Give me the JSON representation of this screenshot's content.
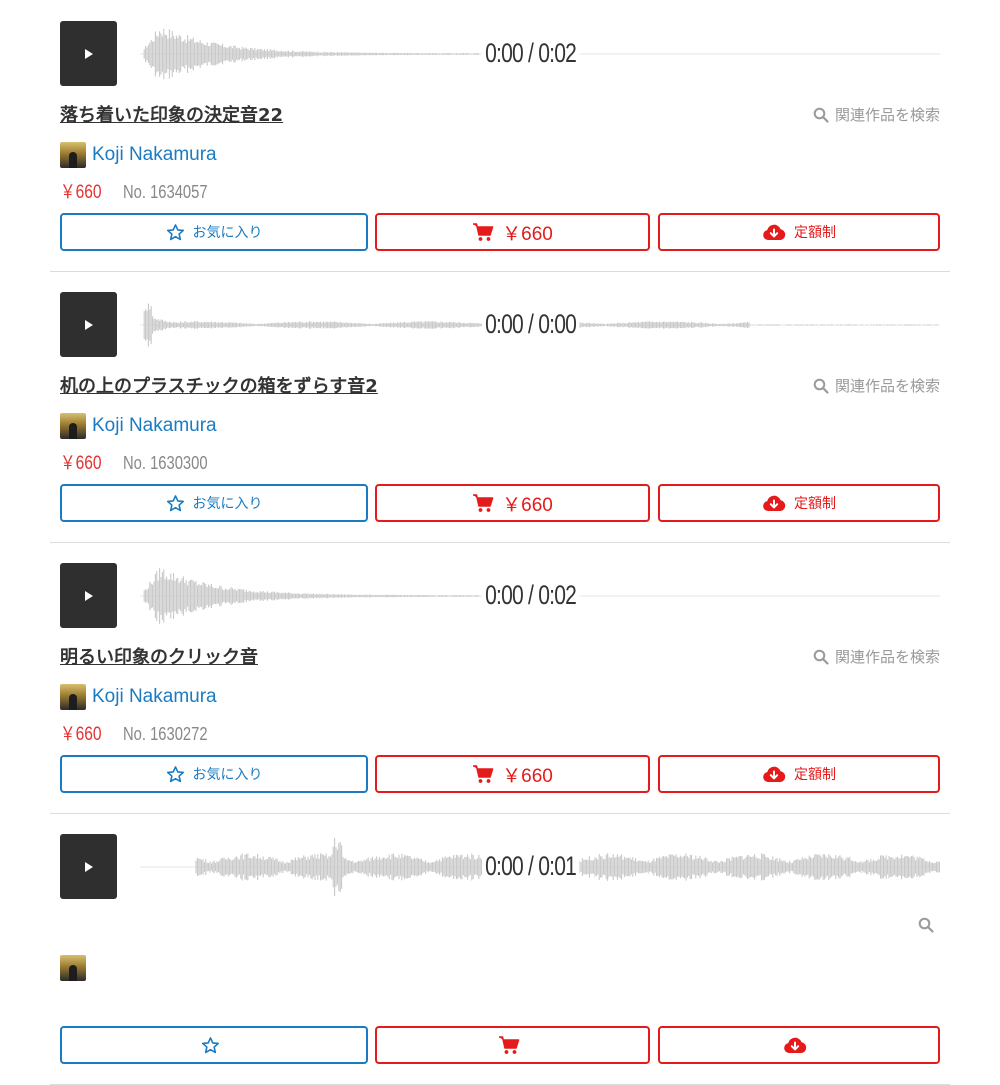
{
  "colors": {
    "accent_blue": "#1a7bc3",
    "accent_red": "#e51a1a",
    "price_red": "#e53333",
    "waveform_gray": "#c8c8c8",
    "play_button": "#2f2f2f"
  },
  "icons": {
    "play": "play-icon",
    "search": "search-icon",
    "favorite": "star-outline-icon",
    "cart": "cart-icon",
    "subscription": "cloud-download-icon"
  },
  "items": [
    {
      "time": "0:00 / 0:02",
      "title": "落ち着いた印象の決定音22",
      "related_label": "関連作品を検索",
      "author": "Koji Nakamura",
      "price": "￥660",
      "number": "No. 1634057",
      "favorite_label": "お気に入り",
      "cart_label": "￥660",
      "subscription_label": "定額制",
      "waveform_shape": "burst"
    },
    {
      "time": "0:00 / 0:00",
      "title": "机の上のプラスチックの箱をずらす音2",
      "related_label": "関連作品を検索",
      "author": "Koji Nakamura",
      "price": "￥660",
      "number": "No. 1630300",
      "favorite_label": "お気に入り",
      "cart_label": "￥660",
      "subscription_label": "定額制",
      "waveform_shape": "flat"
    },
    {
      "time": "0:00 / 0:02",
      "title": "明るい印象のクリック音",
      "related_label": "関連作品を検索",
      "author": "Koji Nakamura",
      "price": "￥660",
      "number": "No. 1630272",
      "favorite_label": "お気に入り",
      "cart_label": "￥660",
      "subscription_label": "定額制",
      "waveform_shape": "burst"
    },
    {
      "time": "0:00 / 0:01",
      "title": "",
      "related_label": "",
      "author": "",
      "price": "",
      "number": "",
      "favorite_label": "",
      "cart_label": "",
      "subscription_label": "",
      "waveform_shape": "dense"
    }
  ]
}
